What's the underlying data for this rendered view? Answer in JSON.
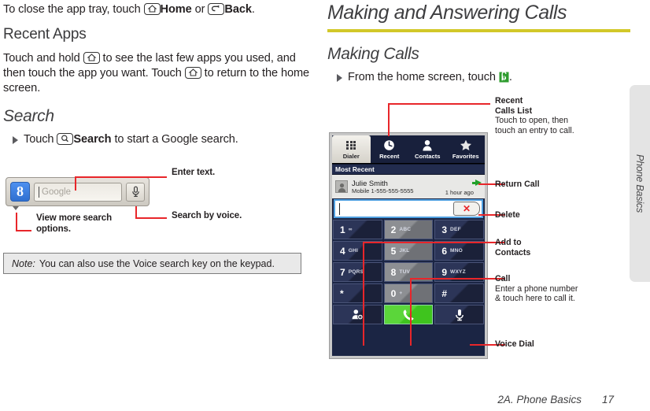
{
  "left": {
    "intro": {
      "pre": "To close the app tray, touch ",
      "home_label": "Home",
      "mid": " or ",
      "back_label": "Back",
      "post": ".",
      "home_icon": "home-icon",
      "back_icon": "back-arrow-icon"
    },
    "recent_apps": {
      "heading": "Recent Apps",
      "para_1": "Touch and hold ",
      "para_2": " to see the last few apps you used, and then touch the app you want. Touch ",
      "para_3": " to return to the home screen."
    },
    "search": {
      "heading": "Search",
      "bullet_pre": "Touch ",
      "bullet_bold": "Search",
      "bullet_post": " to start a Google search.",
      "search_icon": "magnifier-icon"
    },
    "widget": {
      "logo_text": "8",
      "field_placeholder": "Google",
      "mic_icon": "microphone-icon",
      "dropdown_icon": "chevron-down-icon"
    },
    "annotations": {
      "enter_text": "Enter text.",
      "search_by_voice": "Search by voice.",
      "view_more_line1": "View  more search",
      "view_more_line2": "options."
    },
    "note": {
      "label": "Note:",
      "text": "You can also use the Voice search key on the keypad."
    }
  },
  "right": {
    "h1": "Making and Answering Calls",
    "h2": "Making Calls",
    "bullet_pre": "From the home screen, touch ",
    "bullet_post": ".",
    "phone_icon": "phone-app-icon"
  },
  "phone_ui": {
    "tabs": [
      {
        "label": "Dialer",
        "icon": "keypad-grid-icon",
        "active": true
      },
      {
        "label": "Recent",
        "icon": "clock-icon",
        "active": false
      },
      {
        "label": "Contacts",
        "icon": "person-icon",
        "active": false
      },
      {
        "label": "Favorites",
        "icon": "star-icon",
        "active": false
      }
    ],
    "section_header": "Most Recent",
    "recent_entry": {
      "name": "Julie Smith",
      "number": "Mobile 1-555-555-5555",
      "time": "1 hour ago",
      "avatar_icon": "contact-avatar-icon",
      "return_call_icon": "green-right-arrow-icon"
    },
    "input": {
      "value": "",
      "delete_icon": "red-x-delete-icon"
    },
    "keys": [
      [
        {
          "num": "1",
          "sub": "∞"
        },
        {
          "num": "2",
          "sub": "ABC"
        },
        {
          "num": "3",
          "sub": "DEF"
        }
      ],
      [
        {
          "num": "4",
          "sub": "GHI"
        },
        {
          "num": "5",
          "sub": "JKL"
        },
        {
          "num": "6",
          "sub": "MNO"
        }
      ],
      [
        {
          "num": "7",
          "sub": "PQRS"
        },
        {
          "num": "8",
          "sub": "TUV"
        },
        {
          "num": "9",
          "sub": "WXYZ"
        }
      ],
      [
        {
          "num": "*",
          "sub": ""
        },
        {
          "num": "0",
          "sub": "+"
        },
        {
          "num": "#",
          "sub": ""
        }
      ]
    ],
    "actions": [
      {
        "name": "add-to-contacts-button",
        "icon": "add-contact-icon"
      },
      {
        "name": "call-button",
        "icon": "green-handset-icon"
      },
      {
        "name": "voice-dial-button",
        "icon": "microphone-icon"
      }
    ]
  },
  "callouts": {
    "recent_calls_title_1": "Recent",
    "recent_calls_title_2": "Calls List",
    "recent_calls_body": "Touch to open, then touch an entry to call.",
    "return_call": "Return Call",
    "delete": "Delete",
    "add_to_contacts_1": "Add to",
    "add_to_contacts_2": "Contacts",
    "call_title": "Call",
    "call_body": "Enter a phone number & touch here to call it.",
    "voice_dial": "Voice Dial"
  },
  "sidetab": {
    "label": "Phone Basics"
  },
  "footer": {
    "section": "2A. Phone Basics",
    "page": "17"
  },
  "colors": {
    "rule": "#d2c828",
    "callout_red": "#e8262a",
    "screen_bg": "#1b2544",
    "call_green": "#4ecb2c"
  }
}
